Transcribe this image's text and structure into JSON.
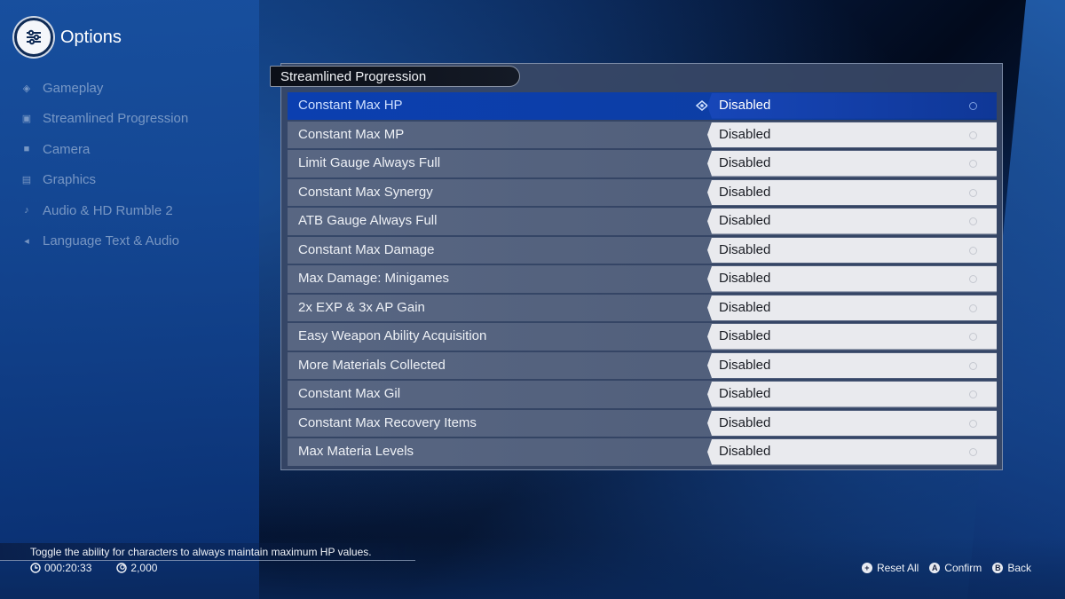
{
  "header": {
    "title": "Options",
    "icon": "settings-sliders-icon"
  },
  "sidebar": {
    "items": [
      {
        "label": "Gameplay",
        "icon": "gameplay-icon"
      },
      {
        "label": "Streamlined Progression",
        "icon": "progression-icon"
      },
      {
        "label": "Camera",
        "icon": "camera-icon"
      },
      {
        "label": "Graphics",
        "icon": "graphics-icon"
      },
      {
        "label": "Audio & HD Rumble 2",
        "icon": "audio-icon"
      },
      {
        "label": "Language Text & Audio",
        "icon": "language-icon"
      }
    ]
  },
  "panel": {
    "title": "Streamlined Progression",
    "rows": [
      {
        "label": "Constant Max HP",
        "value": "Disabled",
        "selected": true
      },
      {
        "label": "Constant Max MP",
        "value": "Disabled"
      },
      {
        "label": "Limit Gauge Always Full",
        "value": "Disabled"
      },
      {
        "label": "Constant Max Synergy",
        "value": "Disabled"
      },
      {
        "label": "ATB Gauge Always Full",
        "value": "Disabled"
      },
      {
        "label": "Constant Max Damage",
        "value": "Disabled"
      },
      {
        "label": "Max Damage: Minigames",
        "value": "Disabled"
      },
      {
        "label": "2x EXP & 3x AP Gain",
        "value": "Disabled"
      },
      {
        "label": "Easy Weapon Ability Acquisition",
        "value": "Disabled"
      },
      {
        "label": "More Materials Collected",
        "value": "Disabled"
      },
      {
        "label": "Constant Max Gil",
        "value": "Disabled"
      },
      {
        "label": "Constant Max Recovery Items",
        "value": "Disabled"
      },
      {
        "label": "Max Materia Levels",
        "value": "Disabled"
      }
    ]
  },
  "footer": {
    "help_text": "Toggle the ability for characters to always maintain maximum HP values.",
    "playtime": "000:20:33",
    "gil": "2,000",
    "controls": [
      {
        "button": "+",
        "label": "Reset All"
      },
      {
        "button": "A",
        "label": "Confirm"
      },
      {
        "button": "B",
        "label": "Back"
      }
    ]
  },
  "colors": {
    "accent": "#0b3fb0",
    "panel": "#384866",
    "value_bg": "#e9eaee"
  }
}
